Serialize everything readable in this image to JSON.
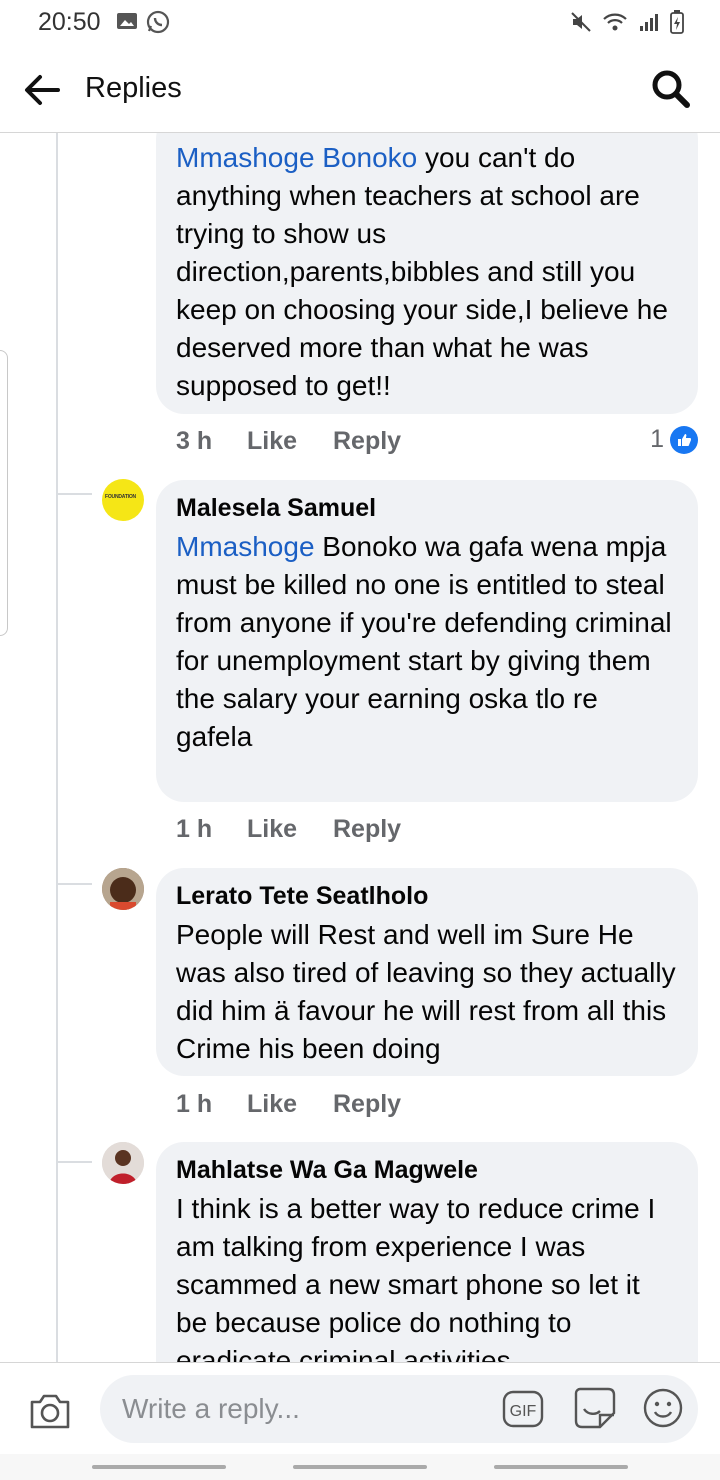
{
  "status_bar": {
    "time": "20:50"
  },
  "header": {
    "title": "Replies"
  },
  "comments": [
    {
      "mention": "Mmashoge Bonoko",
      "text": " you can't do anything when teachers at school are trying to show us direction,parents,bibbles and still you keep on choosing your side,I believe he deserved more than what he was supposed to get!!",
      "time": "3 h",
      "like": "Like",
      "reply": "Reply",
      "reaction_count": "1"
    },
    {
      "author": "Malesela Samuel",
      "mention": "Mmashoge",
      "text": " Bonoko wa gafa wena mpja must be killed no one is entitled to steal from anyone if you're defending criminal  for unemployment start by giving them the salary your earning oska tlo re gafela",
      "time": "1 h",
      "like": "Like",
      "reply": "Reply",
      "avatar_text": "FOUNDATION"
    },
    {
      "author": "Lerato Tete Seatlholo",
      "text": "People will Rest and well im Sure He was also tired  of leaving so they actually did him  ä favour he will rest from all this Crime his been doing",
      "time": "1 h",
      "like": "Like",
      "reply": "Reply"
    },
    {
      "author": "Mahlatse Wa Ga Magwele",
      "text": "I think is a better way to reduce crime I am talking from experience I was scammed a new smart phone so let it be because police do nothing to eradicate criminal activities"
    }
  ],
  "composer": {
    "placeholder": "Write a reply...",
    "gif_label": "GIF"
  },
  "colors": {
    "mention": "#1b5fc4",
    "bubble": "#f0f2f5",
    "like_badge": "#1877f2"
  },
  "icons": [
    "back-arrow-icon",
    "search-icon",
    "camera-icon",
    "gif-icon",
    "sticker-icon",
    "emoji-icon",
    "like-icon"
  ]
}
